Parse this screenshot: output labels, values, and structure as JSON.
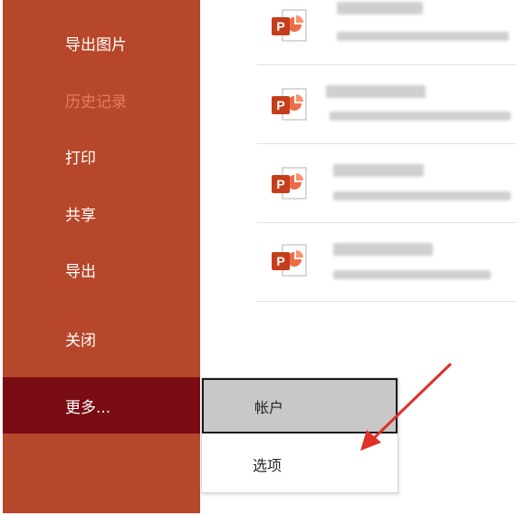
{
  "sidebar": {
    "items": [
      {
        "label": "导出图片",
        "state": "normal"
      },
      {
        "label": "历史记录",
        "state": "muted"
      },
      {
        "label": "打印",
        "state": "normal"
      },
      {
        "label": "共享",
        "state": "normal"
      },
      {
        "label": "导出",
        "state": "normal"
      },
      {
        "label": "关闭",
        "state": "normal"
      },
      {
        "label": "更多...",
        "state": "active"
      }
    ]
  },
  "recent_files": {
    "icon": "powerpoint-icon",
    "count": 4
  },
  "more_menu": {
    "items": [
      {
        "label": "帐户",
        "hovered": true
      },
      {
        "label": "选项",
        "hovered": false
      }
    ]
  },
  "colors": {
    "sidebar_bg": "#b7472a",
    "active_bg": "#7a0c14",
    "muted_text": "#e97a5f",
    "annotation_arrow": "#e0302a"
  }
}
